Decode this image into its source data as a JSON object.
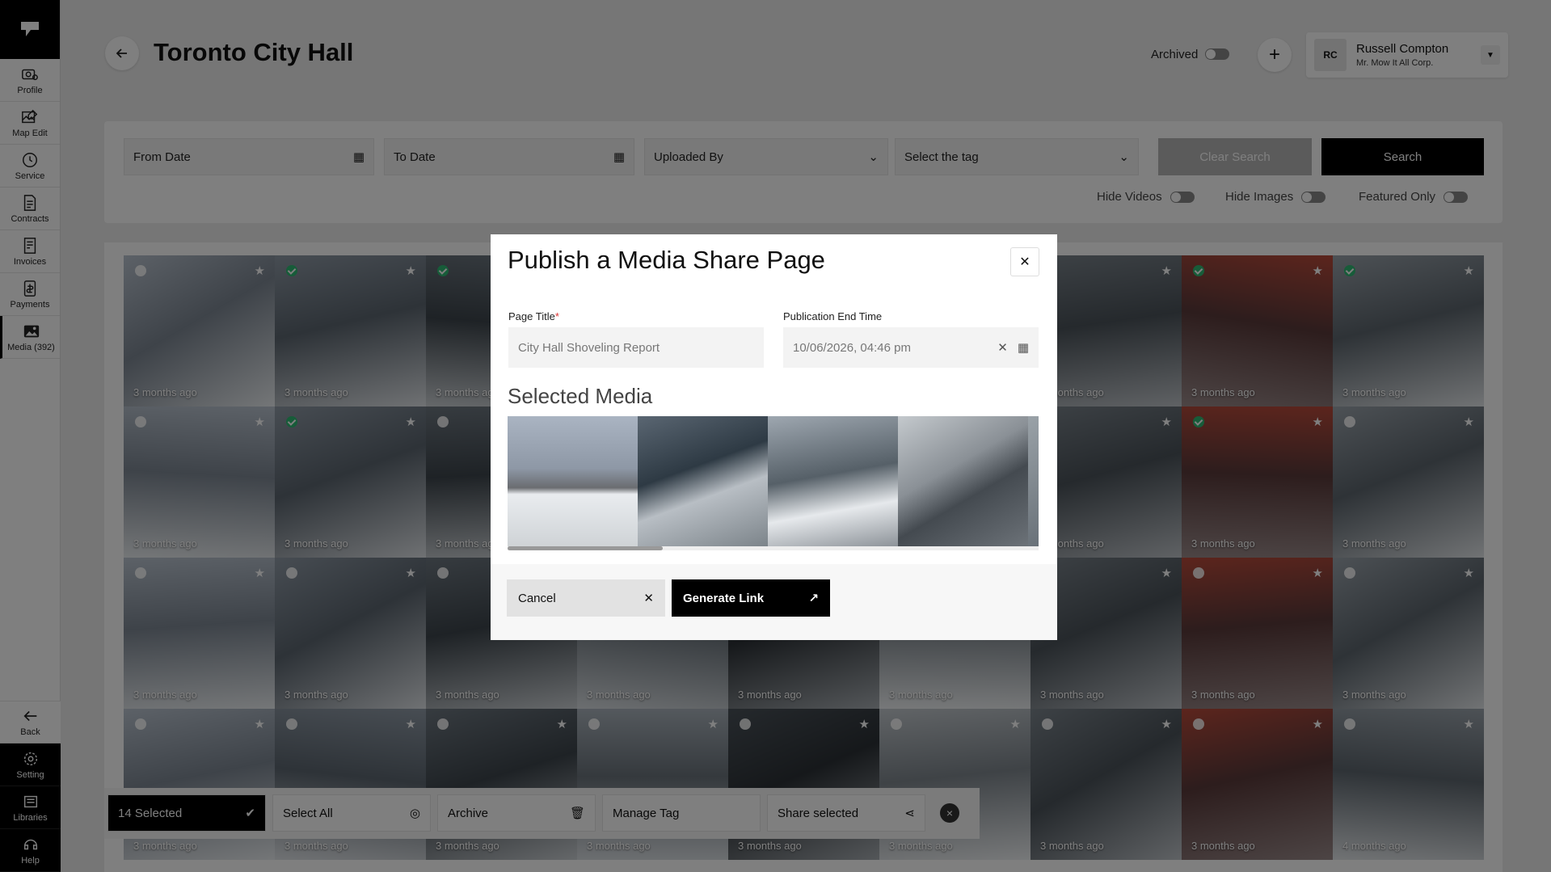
{
  "sidebar": {
    "items": [
      {
        "label": "Profile",
        "icon": "profile-icon"
      },
      {
        "label": "Map Edit",
        "icon": "map-edit-icon"
      },
      {
        "label": "Service",
        "icon": "service-icon"
      },
      {
        "label": "Contracts",
        "icon": "contracts-icon"
      },
      {
        "label": "Invoices",
        "icon": "invoices-icon"
      },
      {
        "label": "Payments",
        "icon": "payments-icon"
      },
      {
        "label": "Media (392)",
        "icon": "media-icon"
      }
    ],
    "bottom": [
      {
        "label": "Back",
        "icon": "back-arrow-icon"
      },
      {
        "label": "Setting",
        "icon": "gear-icon"
      },
      {
        "label": "Libraries",
        "icon": "libraries-icon"
      },
      {
        "label": "Help",
        "icon": "help-icon"
      }
    ]
  },
  "header": {
    "title": "Toronto City Hall",
    "archived_label": "Archived",
    "user": {
      "initials": "RC",
      "name": "Russell Compton",
      "company": "Mr. Mow It All Corp."
    }
  },
  "filters": {
    "from_date": "From Date",
    "to_date": "To Date",
    "uploaded_by": "Uploaded By",
    "tag": "Select the tag",
    "clear": "Clear Search",
    "search": "Search",
    "hide_videos": "Hide Videos",
    "hide_images": "Hide Images",
    "featured_only": "Featured Only"
  },
  "grid": {
    "tiles": [
      "3 months ago",
      "3 months ago",
      "3 months ago",
      "3 months ago",
      "3 months ago",
      "3 months ago",
      "3 months ago",
      "3 months ago",
      "3 months ago",
      "3 months ago",
      "3 months ago",
      "3 months ago",
      "3 months ago",
      "3 months ago",
      "3 months ago",
      "3 months ago",
      "3 months ago",
      "3 months ago",
      "3 months ago",
      "3 months ago",
      "3 months ago",
      "3 months ago",
      "3 months ago",
      "3 months ago",
      "3 months ago",
      "3 months ago",
      "3 months ago",
      "3 months ago",
      "3 months ago",
      "3 months ago",
      "3 months ago",
      "3 months ago",
      "3 months ago",
      "3 months ago",
      "3 months ago",
      "4 months ago"
    ]
  },
  "actionbar": {
    "selected": "14 Selected",
    "select_all": "Select All",
    "archive": "Archive",
    "manage_tag": "Manage Tag",
    "share": "Share selected"
  },
  "modal": {
    "title": "Publish a Media Share Page",
    "page_title_label": "Page Title",
    "page_title_required": "*",
    "page_title_value": "City Hall Shoveling Report",
    "end_time_label": "Publication End Time",
    "end_time_value": "10/06/2026, 04:46 pm",
    "selected_media_title": "Selected Media",
    "cancel": "Cancel",
    "generate": "Generate Link"
  },
  "colors": {
    "accent": "#000000",
    "selected_check": "#2eb872"
  }
}
